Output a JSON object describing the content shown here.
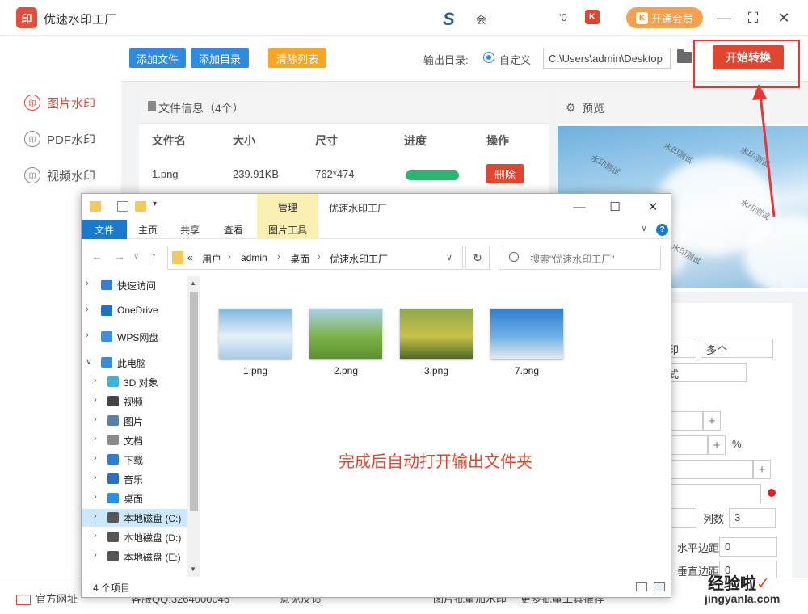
{
  "app": {
    "logo": "印",
    "title": "优速水印工厂",
    "brand_s": "S",
    "brand_hui": "会",
    "brand_zero": "'0",
    "brand_k": "K",
    "vip_k": "K",
    "vip_label": "开通会员",
    "minimize": "—",
    "maximize": "⛶",
    "close": "✕"
  },
  "sidebar": {
    "items": [
      {
        "icon": "印",
        "label": "图片水印",
        "active": true
      },
      {
        "icon": "印",
        "label": "PDF水印",
        "active": false
      },
      {
        "icon": "印",
        "label": "视频水印",
        "active": false
      }
    ]
  },
  "toolbar": {
    "add_file": "添加文件",
    "add_dir": "添加目录",
    "clear_list": "清除列表",
    "output_label": "输出目录:",
    "custom_label": "自定义",
    "output_path": "C:\\Users\\admin\\Desktop",
    "start": "开始转换"
  },
  "file_panel": {
    "title": "文件信息（4个）",
    "columns": [
      "文件名",
      "大小",
      "尺寸",
      "进度",
      "操作"
    ],
    "rows": [
      {
        "name": "1.png",
        "size": "239.91KB",
        "dims": "762*474",
        "progress": 1.0,
        "action": "删除"
      }
    ]
  },
  "preview": {
    "title": "预览",
    "gear": "⚙",
    "watermark": "水印测试"
  },
  "settings": {
    "suffix_visible": "印",
    "multi": "多个",
    "style_suffix": "式",
    "percent": "%",
    "cols_label": "列数",
    "cols_value": "3",
    "hmargin_label": "水平边距",
    "hmargin_value": "0",
    "vmargin_label": "垂直边距",
    "vmargin_value": "0",
    "plus": "+"
  },
  "bottombar": {
    "official_site": "官方网址",
    "qq_partial": "客服QQ:3264000046",
    "feedback_partial": "意见反馈",
    "help_partial": "图片批量加水印",
    "more_partial": "更多批量工具推荐"
  },
  "explorer": {
    "manage_tab": "管理",
    "window_name": "优速水印工厂",
    "minimize": "—",
    "maximize": "☐",
    "close": "✕",
    "ribbon_tabs": [
      "文件",
      "主页",
      "共享",
      "查看",
      "图片工具"
    ],
    "help": "?",
    "chevron": "∨",
    "nav_back": "←",
    "nav_forward": "→",
    "nav_dropdown": "∨",
    "nav_up": "↑",
    "breadcrumb": [
      "«",
      "用户",
      "admin",
      "桌面",
      "优速水印工厂"
    ],
    "breadcrumb_sep": "›",
    "addr_dropdown": "∨",
    "refresh": "↻",
    "search_placeholder": "搜索\"优速水印工厂\"",
    "nav_items": [
      {
        "label": "快速访问",
        "icon": "star-icon",
        "color": "#3a7bd5",
        "indent": 0
      },
      {
        "label": "OneDrive",
        "icon": "cloud-icon",
        "color": "#1a73c9",
        "indent": 0
      },
      {
        "label": "WPS网盘",
        "icon": "cloud-icon",
        "color": "#3d8fe0",
        "indent": 0
      },
      {
        "label": "此电脑",
        "icon": "computer-icon",
        "color": "#3b8ad6",
        "indent": 0
      },
      {
        "label": "3D 对象",
        "icon": "cube-icon",
        "color": "#3cb3dd",
        "indent": 1
      },
      {
        "label": "视频",
        "icon": "video-icon",
        "color": "#444444",
        "indent": 1
      },
      {
        "label": "图片",
        "icon": "picture-icon",
        "color": "#5a7fa8",
        "indent": 1
      },
      {
        "label": "文档",
        "icon": "document-icon",
        "color": "#8a8a8a",
        "indent": 1
      },
      {
        "label": "下载",
        "icon": "download-icon",
        "color": "#2a7fd4",
        "indent": 1
      },
      {
        "label": "音乐",
        "icon": "music-icon",
        "color": "#2a6fc4",
        "indent": 1
      },
      {
        "label": "桌面",
        "icon": "desktop-icon",
        "color": "#2a8fe0",
        "indent": 1
      },
      {
        "label": "本地磁盘 (C:)",
        "icon": "drive-icon",
        "color": "#555555",
        "indent": 1,
        "selected": true
      },
      {
        "label": "本地磁盘 (D:)",
        "icon": "drive-icon",
        "color": "#555555",
        "indent": 1
      },
      {
        "label": "本地磁盘 (E:)",
        "icon": "drive-icon",
        "color": "#555555",
        "indent": 1
      }
    ],
    "files": [
      {
        "name": "1.png",
        "colors": [
          "#7fb6e0",
          "#e4f0f8",
          "#a8cce8"
        ]
      },
      {
        "name": "2.png",
        "colors": [
          "#a7d0e8",
          "#7db34a",
          "#5c8f2e"
        ]
      },
      {
        "name": "3.png",
        "colors": [
          "#8fa84a",
          "#c9c24a",
          "#4d6a26"
        ]
      },
      {
        "name": "7.png",
        "colors": [
          "#2f7fcf",
          "#6db0e6",
          "#e8e8e8"
        ]
      }
    ],
    "note": "完成后自动打开输出文件夹",
    "status": "4 个项目"
  },
  "watermark_site": {
    "title": "经验啦",
    "check": "✓",
    "url": "jingyanla.com"
  },
  "colors": {
    "accent": "#e2452f",
    "blue_btn": "#2f8ae0",
    "orange_btn": "#f5a623",
    "vip": "#f6a04d",
    "progress": "#2ab66e"
  }
}
